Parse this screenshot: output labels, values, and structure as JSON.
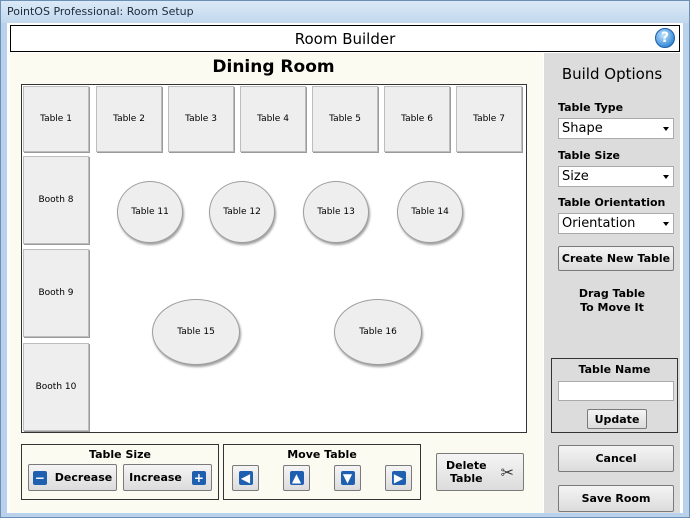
{
  "window": {
    "title": "PointOS Professional: Room Setup"
  },
  "header": {
    "title": "Room Builder",
    "help_label": "?"
  },
  "room": {
    "title": "Dining Room"
  },
  "tables": [
    {
      "label": "Table 1",
      "shape": "rect"
    },
    {
      "label": "Table 2",
      "shape": "rect"
    },
    {
      "label": "Table 3",
      "shape": "rect"
    },
    {
      "label": "Table 4",
      "shape": "rect"
    },
    {
      "label": "Table 5",
      "shape": "rect"
    },
    {
      "label": "Table 6",
      "shape": "rect"
    },
    {
      "label": "Table 7",
      "shape": "rect"
    },
    {
      "label": "Booth 8",
      "shape": "rect"
    },
    {
      "label": "Booth 9",
      "shape": "rect"
    },
    {
      "label": "Booth 10",
      "shape": "rect"
    },
    {
      "label": "Table 11",
      "shape": "round"
    },
    {
      "label": "Table 12",
      "shape": "round"
    },
    {
      "label": "Table 13",
      "shape": "round"
    },
    {
      "label": "Table 14",
      "shape": "round"
    },
    {
      "label": "Table 15",
      "shape": "round"
    },
    {
      "label": "Table 16",
      "shape": "round"
    }
  ],
  "table_size": {
    "label": "Table Size",
    "decrease": "Decrease",
    "increase": "Increase"
  },
  "move_table": {
    "label": "Move Table"
  },
  "delete_table": {
    "line1": "Delete",
    "line2": "Table"
  },
  "build_options": {
    "title": "Build Options",
    "table_type_label": "Table Type",
    "table_type_value": "Shape",
    "table_size_label": "Table Size",
    "table_size_value": "Size",
    "table_orientation_label": "Table Orientation",
    "table_orientation_value": "Orientation",
    "create_button": "Create New Table",
    "drag_hint_line1": "Drag Table",
    "drag_hint_line2": "To Move It",
    "table_name_label": "Table Name",
    "table_name_value": "",
    "update_button": "Update",
    "cancel_button": "Cancel",
    "save_button": "Save Room"
  },
  "colors": {
    "accent": "#1f5fb0",
    "panel": "#dcdcdc",
    "room_bg": "#fcfbf1"
  }
}
